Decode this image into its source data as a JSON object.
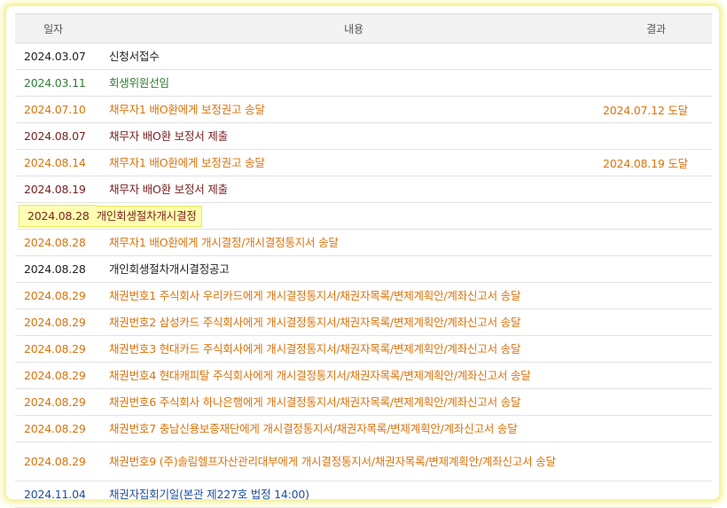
{
  "headers": {
    "date": "일자",
    "content": "내용",
    "result": "결과"
  },
  "colors": {
    "black": "#222222",
    "green": "#2e7d32",
    "orange": "#d9730d",
    "maroon": "#7a2222",
    "blue": "#1f4f9c",
    "highlight": "#feffb0",
    "frame": "#f7f3a6"
  },
  "rows": [
    {
      "date": "2024.03.07",
      "content": "신청서접수",
      "result": "",
      "color": "black"
    },
    {
      "date": "2024.03.11",
      "content": "회생위원선임",
      "result": "",
      "color": "green"
    },
    {
      "date": "2024.07.10",
      "content": "채무자1 배O환에게 보정권고 송달",
      "result": "2024.07.12 도달",
      "color": "orange"
    },
    {
      "date": "2024.08.07",
      "content": "채무자 배O환 보정서 제출",
      "result": "",
      "color": "maroon"
    },
    {
      "date": "2024.08.14",
      "content": "채무자1 배O환에게 보정권고 송달",
      "result": "2024.08.19 도달",
      "color": "orange"
    },
    {
      "date": "2024.08.19",
      "content": "채무자 배O환 보정서 제출",
      "result": "",
      "color": "maroon"
    },
    {
      "date": "2024.08.28",
      "content": "개인회생절차개시결정",
      "result": "",
      "color": "maroon",
      "highlight": true
    },
    {
      "date": "2024.08.28",
      "content": "채무자1 배O환에게 개시결정/개시결정통지서 송달",
      "result": "",
      "color": "orange"
    },
    {
      "date": "2024.08.28",
      "content": "개인회생절차개시결정공고",
      "result": "",
      "color": "black"
    },
    {
      "date": "2024.08.29",
      "content": "채권번호1 주식회사 우리카드에게 개시결정통지서/채권자목록/변제계획안/계좌신고서 송달",
      "result": "",
      "color": "orange"
    },
    {
      "date": "2024.08.29",
      "content": "채권번호2 삼성카드 주식회사에게 개시결정통지서/채권자목록/변제계획안/계좌신고서 송달",
      "result": "",
      "color": "orange"
    },
    {
      "date": "2024.08.29",
      "content": "채권번호3 현대카드 주식회사에게 개시결정통지서/채권자목록/변제계획안/계좌신고서 송달",
      "result": "",
      "color": "orange"
    },
    {
      "date": "2024.08.29",
      "content": "채권번호4 현대캐피탈 주식회사에게 개시결정통지서/채권자목록/변제계획안/계좌신고서 송달",
      "result": "",
      "color": "orange"
    },
    {
      "date": "2024.08.29",
      "content": "채권번호6 주식회사 하나은행에게 개시결정통지서/채권자목록/변제계획안/계좌신고서 송달",
      "result": "",
      "color": "orange"
    },
    {
      "date": "2024.08.29",
      "content": "채권번호7 충남신용보증재단에게 개시결정통지서/채권자목록/변제계획안/계좌신고서 송달",
      "result": "",
      "color": "orange"
    },
    {
      "date": "2024.08.29",
      "content": "채권번호9 (주)솔림헬프자산관리대부에게 개시결정통지서/채권자목록/변제계획안/계좌신고서 송달",
      "result": "",
      "color": "orange",
      "tall": true
    },
    {
      "date": "2024.11.04",
      "content": "채권자집회기일(본관 제227호 법정 14:00)",
      "result": "",
      "color": "blue"
    }
  ]
}
